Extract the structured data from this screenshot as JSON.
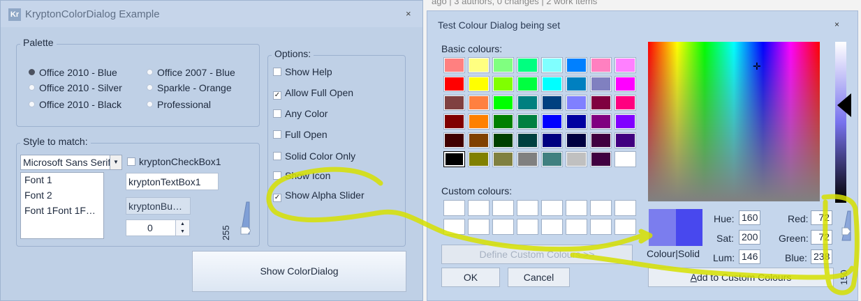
{
  "background": {
    "text": "ago | 3 authors, 0 changes | 2 work items"
  },
  "kwin": {
    "logo": "Kr",
    "title": "KryptonColorDialog Example",
    "close": "×",
    "palette": {
      "title": "Palette",
      "options": [
        "Office 2010 - Blue",
        "Office 2007 - Blue",
        "Office 2010 - Silver",
        "Sparkle - Orange",
        "Office 2010 - Black",
        "Professional"
      ],
      "selected": "Office 2010 - Blue"
    },
    "options": {
      "title": "Options:",
      "items": [
        {
          "label": "Show Help",
          "checked": false
        },
        {
          "label": "Allow Full Open",
          "checked": true
        },
        {
          "label": "Any Color",
          "checked": false
        },
        {
          "label": "Full Open",
          "checked": false
        },
        {
          "label": "Solid Color Only",
          "checked": false
        },
        {
          "label": "Show Icon",
          "checked": false
        },
        {
          "label": "Show Alpha Slider",
          "checked": true
        }
      ]
    },
    "style": {
      "title": "Style to match:",
      "font_combo": "Microsoft Sans Serif",
      "fonts": [
        "Font 1",
        "Font 2",
        "Font  1Font  1F…"
      ],
      "checkbox": "kryptonCheckBox1",
      "textbox": "kryptonTextBox1",
      "button": "kryptonBu…",
      "numeric": "0",
      "slider_value": "255"
    },
    "show_button": "Show ColorDialog"
  },
  "dialog": {
    "title": "Test Colour Dialog being set",
    "close": "×",
    "basic_label": "Basic colours:",
    "custom_label": "Custom colours:",
    "basic_colours": [
      "#ff8080",
      "#ffff80",
      "#80ff80",
      "#00ff80",
      "#80ffff",
      "#0080ff",
      "#ff80c0",
      "#ff80ff",
      "#ff0000",
      "#ffff00",
      "#80ff00",
      "#00ff40",
      "#00ffff",
      "#0080c0",
      "#8080c0",
      "#ff00ff",
      "#804040",
      "#ff8040",
      "#00ff00",
      "#008080",
      "#004080",
      "#8080ff",
      "#800040",
      "#ff0080",
      "#800000",
      "#ff8000",
      "#008000",
      "#008040",
      "#0000ff",
      "#0000a0",
      "#800080",
      "#8000ff",
      "#400000",
      "#804000",
      "#004000",
      "#004040",
      "#000080",
      "#000040",
      "#400040",
      "#400080",
      "#000000",
      "#808000",
      "#808040",
      "#808080",
      "#408080",
      "#c0c0c0",
      "#400040",
      "#ffffff"
    ],
    "selected_basic_index": 40,
    "custom_colours": [
      "#ffffff",
      "#ffffff",
      "#ffffff",
      "#ffffff",
      "#ffffff",
      "#ffffff",
      "#ffffff",
      "#ffffff",
      "#ffffff",
      "#ffffff",
      "#ffffff",
      "#ffffff",
      "#ffffff",
      "#ffffff",
      "#ffffff",
      "#ffffff"
    ],
    "define_button": "Define Custom Colours >>",
    "ok_button": "OK",
    "cancel_button": "Cancel",
    "preview_label": "Colour|Solid",
    "hue_label": "Hue:",
    "hue": "160",
    "sat_label": "Sat:",
    "sat": "200",
    "lum_label": "Lum:",
    "lum": "146",
    "red_label": "Red:",
    "red": "72",
    "green_label": "Green:",
    "green": "72",
    "blue_label": "Blue:",
    "blue": "238",
    "add_button_prefix": "A",
    "add_button_rest": "dd to Custom Colours",
    "alpha_value": "150",
    "crosshair": "✛"
  },
  "colors": {
    "highlight_scribble": "#d6e000",
    "current_colour": "#4848ee",
    "preview_left": "#7b7dee"
  }
}
